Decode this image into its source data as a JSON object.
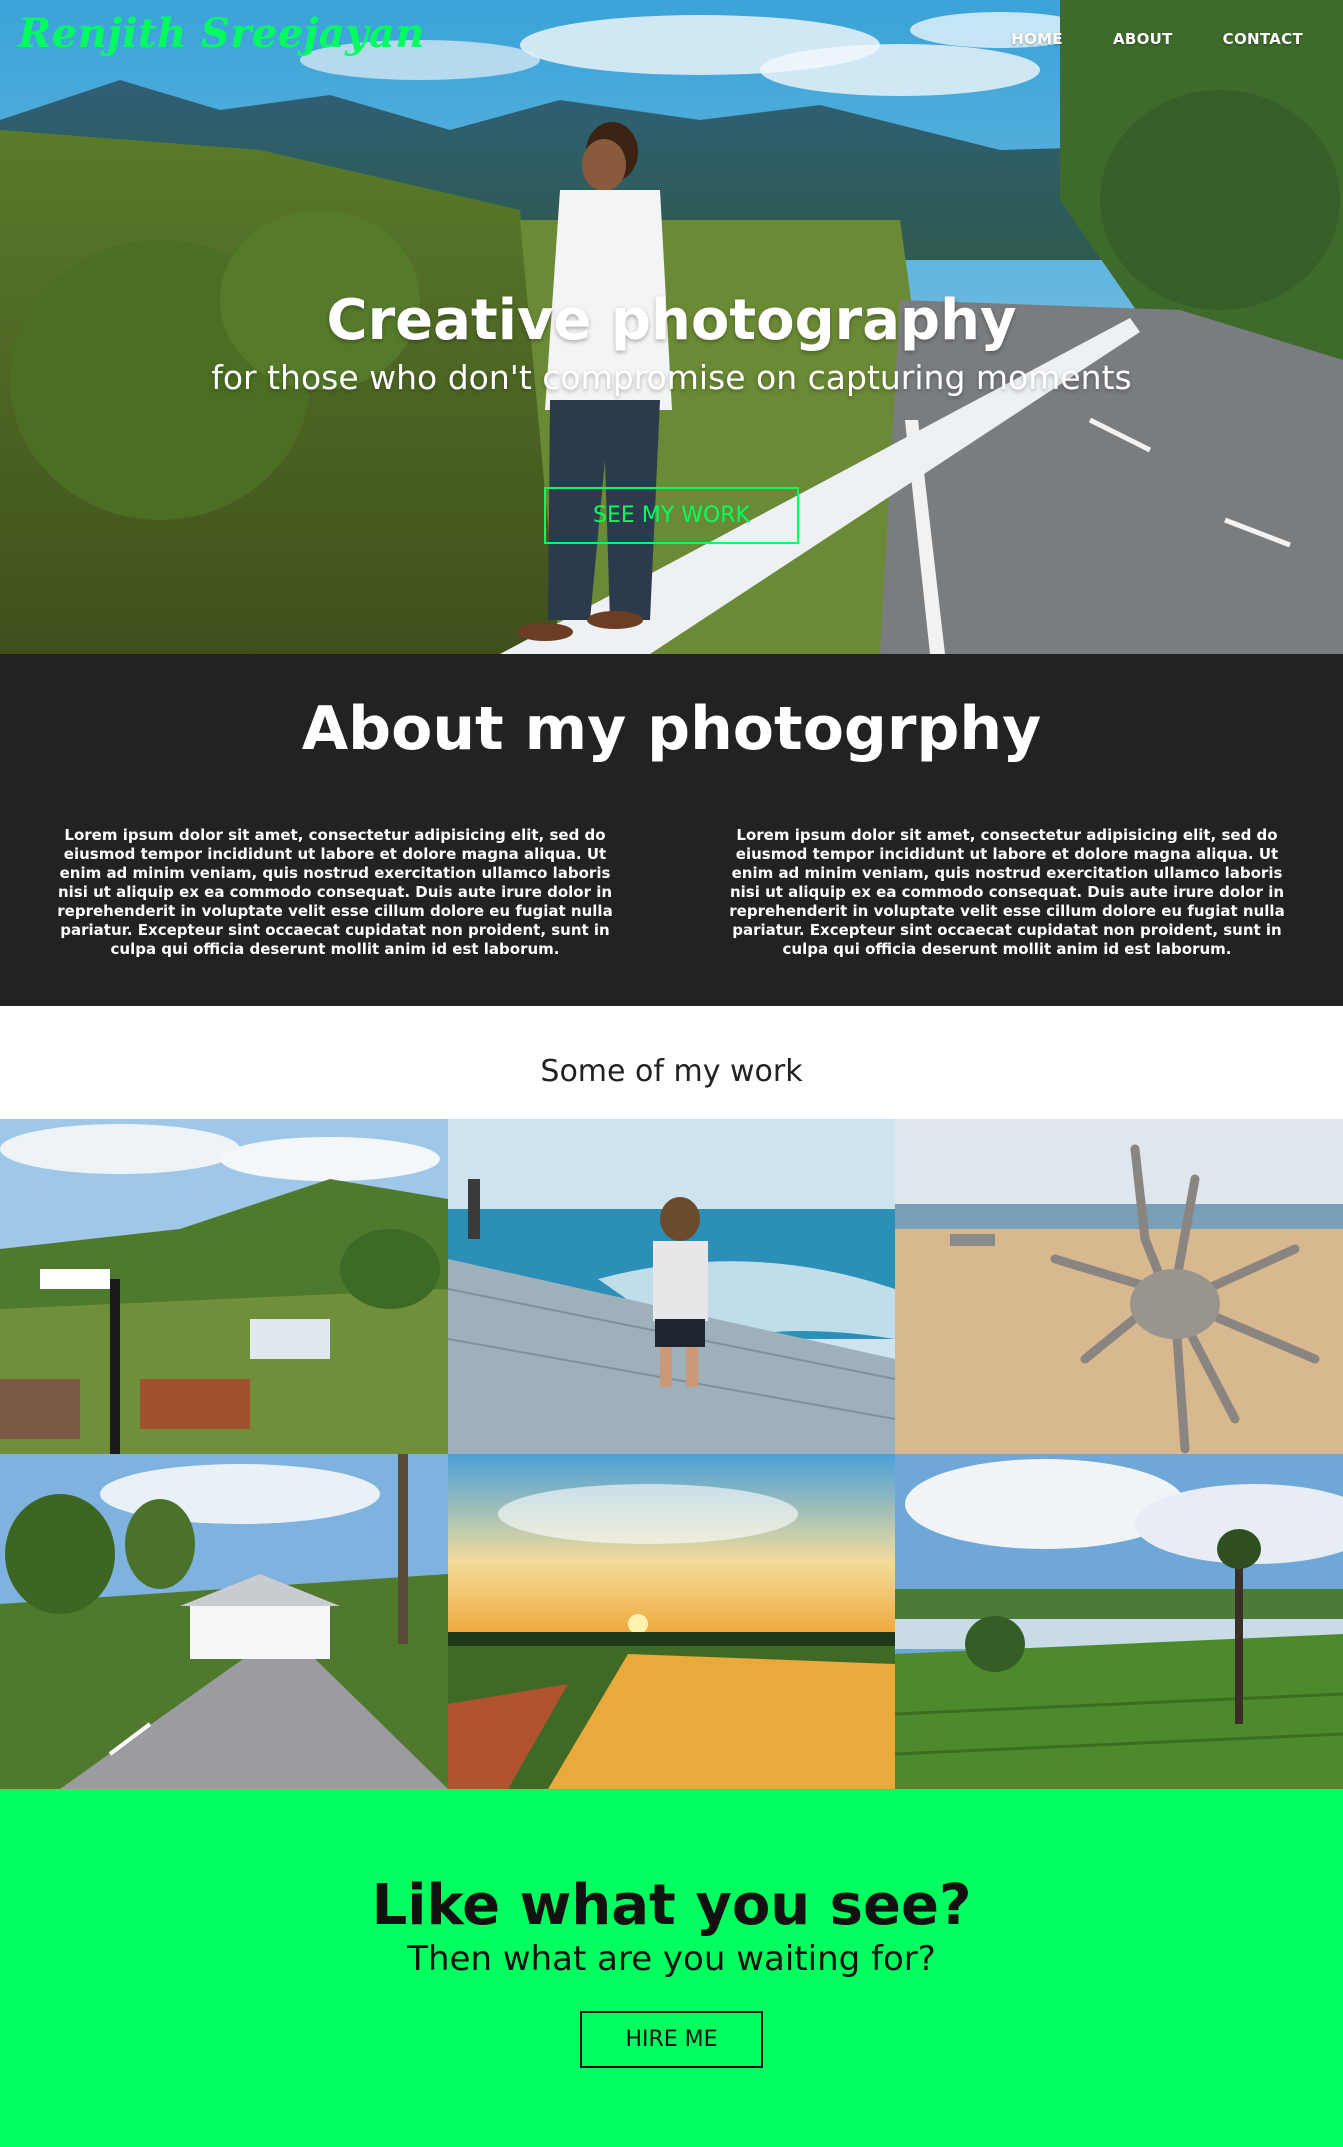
{
  "navbar": {
    "logo": "Renjith Sreejayan",
    "links": [
      "HOME",
      "ABOUT",
      "CONTACT"
    ]
  },
  "hero": {
    "title": "Creative photography",
    "subtitle": "for those who don't compromise on capturing moments",
    "button_label": "SEE MY WORK"
  },
  "about": {
    "title": "About my photogrphy",
    "paragraphs": [
      "Lorem ipsum dolor sit amet, consectetur adipisicing elit, sed do eiusmod tempor incididunt ut labore et dolore magna aliqua. Ut enim ad minim veniam, quis nostrud exercitation ullamco laboris nisi ut aliquip ex ea commodo consequat. Duis aute irure dolor in reprehenderit in voluptate velit esse cillum dolore eu fugiat nulla pariatur. Excepteur sint occaecat cupidatat non proident, sunt in culpa qui officia deserunt mollit anim id est laborum.",
      "Lorem ipsum dolor sit amet, consectetur adipisicing elit, sed do eiusmod tempor incididunt ut labore et dolore magna aliqua. Ut enim ad minim veniam, quis nostrud exercitation ullamco laboris nisi ut aliquip ex ea commodo consequat. Duis aute irure dolor in reprehenderit in voluptate velit esse cillum dolore eu fugiat nulla pariatur. Excepteur sint occaecat cupidatat non proident, sunt in culpa qui officia deserunt mollit anim id est laborum."
    ]
  },
  "work": {
    "title": "Some of my work"
  },
  "cta": {
    "title": "Like what you see?",
    "subtitle": "Then what are you waiting for?",
    "button_label": "HIRE ME"
  },
  "colors": {
    "accent": "#00ff5f",
    "dark_section": "#222222",
    "text_dark": "#111111"
  }
}
